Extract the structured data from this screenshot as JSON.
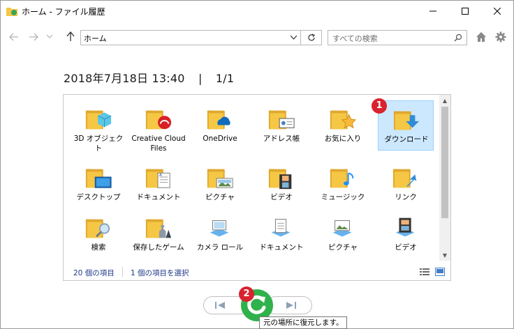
{
  "window": {
    "title": "ホーム - ファイル履歴",
    "minimize_label": "—",
    "maximize_label": "☐",
    "close_label": "✕"
  },
  "nav": {
    "back_icon": "arrow-left-icon",
    "forward_icon": "arrow-right-icon",
    "up_icon": "arrow-up-icon",
    "address": "ホーム",
    "search_placeholder": "すべての検索"
  },
  "snapshot": {
    "date": "2018年7月18日 13:40",
    "separator": "|",
    "page": "1/1"
  },
  "items": [
    {
      "label": "3D オブジェクト",
      "icon": "3d-objects-folder-icon"
    },
    {
      "label": "Creative Cloud Files",
      "icon": "creative-cloud-folder-icon"
    },
    {
      "label": "OneDrive",
      "icon": "onedrive-folder-icon"
    },
    {
      "label": "アドレス帳",
      "icon": "contacts-folder-icon"
    },
    {
      "label": "お気に入り",
      "icon": "favorites-folder-icon"
    },
    {
      "label": "ダウンロード",
      "icon": "downloads-folder-icon",
      "selected": true
    },
    {
      "label": "デスクトップ",
      "icon": "desktop-folder-icon"
    },
    {
      "label": "ドキュメント",
      "icon": "documents-folder-icon"
    },
    {
      "label": "ピクチャ",
      "icon": "pictures-folder-icon"
    },
    {
      "label": "ビデオ",
      "icon": "videos-folder-icon"
    },
    {
      "label": "ミュージック",
      "icon": "music-folder-icon"
    },
    {
      "label": "リンク",
      "icon": "links-folder-icon"
    },
    {
      "label": "検索",
      "icon": "searches-folder-icon"
    },
    {
      "label": "保存したゲーム",
      "icon": "saved-games-folder-icon"
    },
    {
      "label": "カメラ ロール",
      "icon": "camera-roll-library-icon"
    },
    {
      "label": "ドキュメント",
      "icon": "documents-library-icon"
    },
    {
      "label": "ピクチャ",
      "icon": "pictures-library-icon"
    },
    {
      "label": "ビデオ",
      "icon": "videos-library-icon"
    }
  ],
  "status": {
    "count": "20 個の項目",
    "selection": "1 個の項目を選択"
  },
  "badges": {
    "one": "1",
    "two": "2"
  },
  "controls": {
    "tooltip": "元の場所に復元します。"
  },
  "colors": {
    "folder": "#f5c745",
    "folder_dark": "#e0a82e",
    "selection": "#cce8ff",
    "badge": "#d9232e",
    "restore": "#2fb24b",
    "status_text": "#1f3a8a"
  }
}
